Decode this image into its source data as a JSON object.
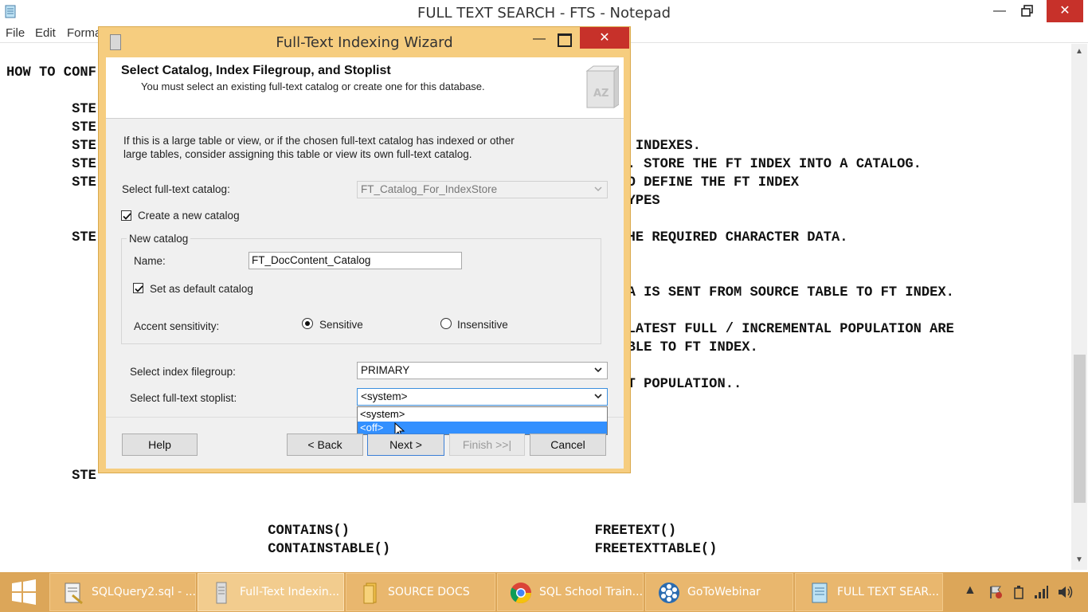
{
  "notepad": {
    "title": "FULL TEXT SEARCH - FTS - Notepad",
    "menu": [
      "File",
      "Edit",
      "Format"
    ],
    "lines": [
      "HOW TO CONF",
      "",
      "        STE",
      "        STE",
      "        STE                                                            RE FT INDEXES.",
      "        STE                                                            INDEX. STORE THE FT INDEX INTO A CATALOG.",
      "        STE                                                           NEED TO DEFINE THE FT INDEX",
      "                                                                      RRED TYPES",
      "",
      "        STE                                                           WITH THE REQUIRED CHARACTER DATA.",
      "",
      "",
      "                                                                      MN DATA IS SENT FROM SOURCE TABLE TO FT INDEX.",
      "",
      "                                                                      SINCE LATEST FULL / INCREMENTAL POPULATION ARE",
      "                                                                      RCE TABLE TO FT INDEX.",
      "",
      "                                                                       THE FT POPULATION..",
      "",
      "",
      "",
      "",
      "        STE",
      "",
      "",
      "                                CONTAINS()                              FREETEXT()",
      "                                CONTAINSTABLE()                         FREETEXTTABLE()",
      "",
      "==============================================="
    ]
  },
  "wizard": {
    "title": "Full-Text Indexing Wizard",
    "header_title": "Select Catalog, Index Filegroup, and Stoplist",
    "header_subtitle": "You must select an existing full-text catalog or create one for this database.",
    "intro_line1": "If this is a large table or view, or if the chosen full-text catalog has indexed or other",
    "intro_line2": "large tables, consider assigning this table or view its own full-text catalog.",
    "catalog_label": "Select full-text catalog:",
    "catalog_value": "FT_Catalog_For_IndexStore",
    "create_new_label": "Create a new catalog",
    "new_catalog_group": "New catalog",
    "name_label": "Name:",
    "name_value": "FT_DocContent_Catalog",
    "default_catalog_label": "Set as default catalog",
    "accent_label": "Accent sensitivity:",
    "sensitive_label": "Sensitive",
    "insensitive_label": "Insensitive",
    "filegroup_label": "Select index filegroup:",
    "filegroup_value": "PRIMARY",
    "stoplist_label": "Select full-text stoplist:",
    "stoplist_value": "<system>",
    "stoplist_options": [
      "<system>",
      "<off>"
    ],
    "buttons": {
      "help": "Help",
      "back": "< Back",
      "next": "Next >",
      "finish": "Finish >>|",
      "cancel": "Cancel"
    }
  },
  "taskbar": {
    "items": [
      {
        "label": "SQLQuery2.sql - ...",
        "icon": "sql-query-icon"
      },
      {
        "label": "Full-Text Indexin...",
        "icon": "wizard-icon"
      },
      {
        "label": "SOURCE DOCS",
        "icon": "folder-icon"
      },
      {
        "label": "SQL School Train...",
        "icon": "chrome-icon"
      },
      {
        "label": "GoToWebinar",
        "icon": "gotowebinar-icon"
      },
      {
        "label": "FULL TEXT SEAR...",
        "icon": "notepad-icon"
      }
    ]
  }
}
